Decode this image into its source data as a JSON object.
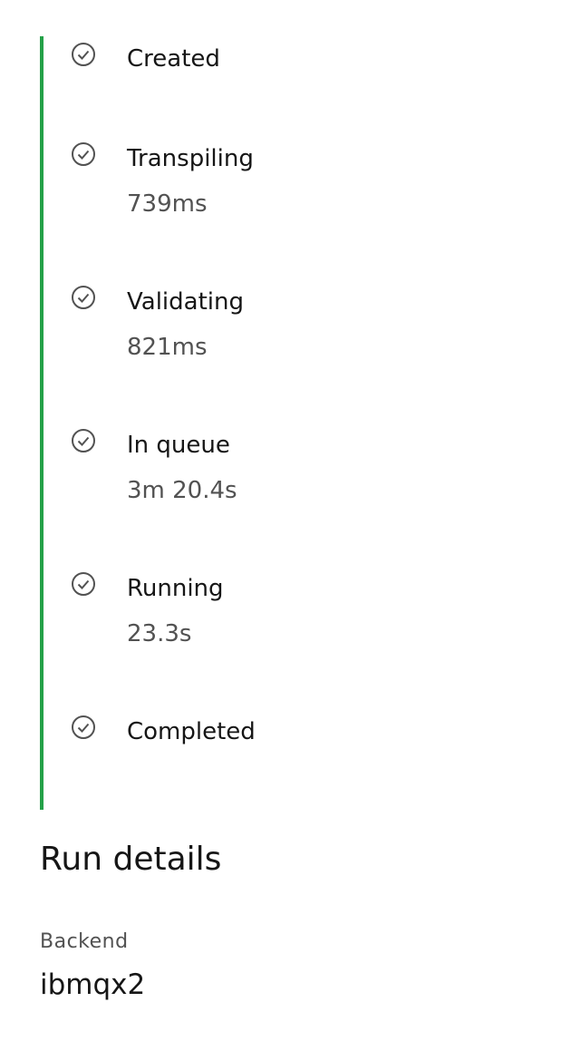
{
  "status_timeline": {
    "accent_color": "#24a148",
    "icon": "checkmark-outline-icon",
    "steps": [
      {
        "label": "Created",
        "duration": ""
      },
      {
        "label": "Transpiling",
        "duration": "739ms"
      },
      {
        "label": "Validating",
        "duration": "821ms"
      },
      {
        "label": "In queue",
        "duration": "3m 20.4s"
      },
      {
        "label": "Running",
        "duration": "23.3s"
      },
      {
        "label": "Completed",
        "duration": ""
      }
    ]
  },
  "run_details": {
    "title": "Run details",
    "backend_label": "Backend",
    "backend_value": "ibmqx2"
  }
}
